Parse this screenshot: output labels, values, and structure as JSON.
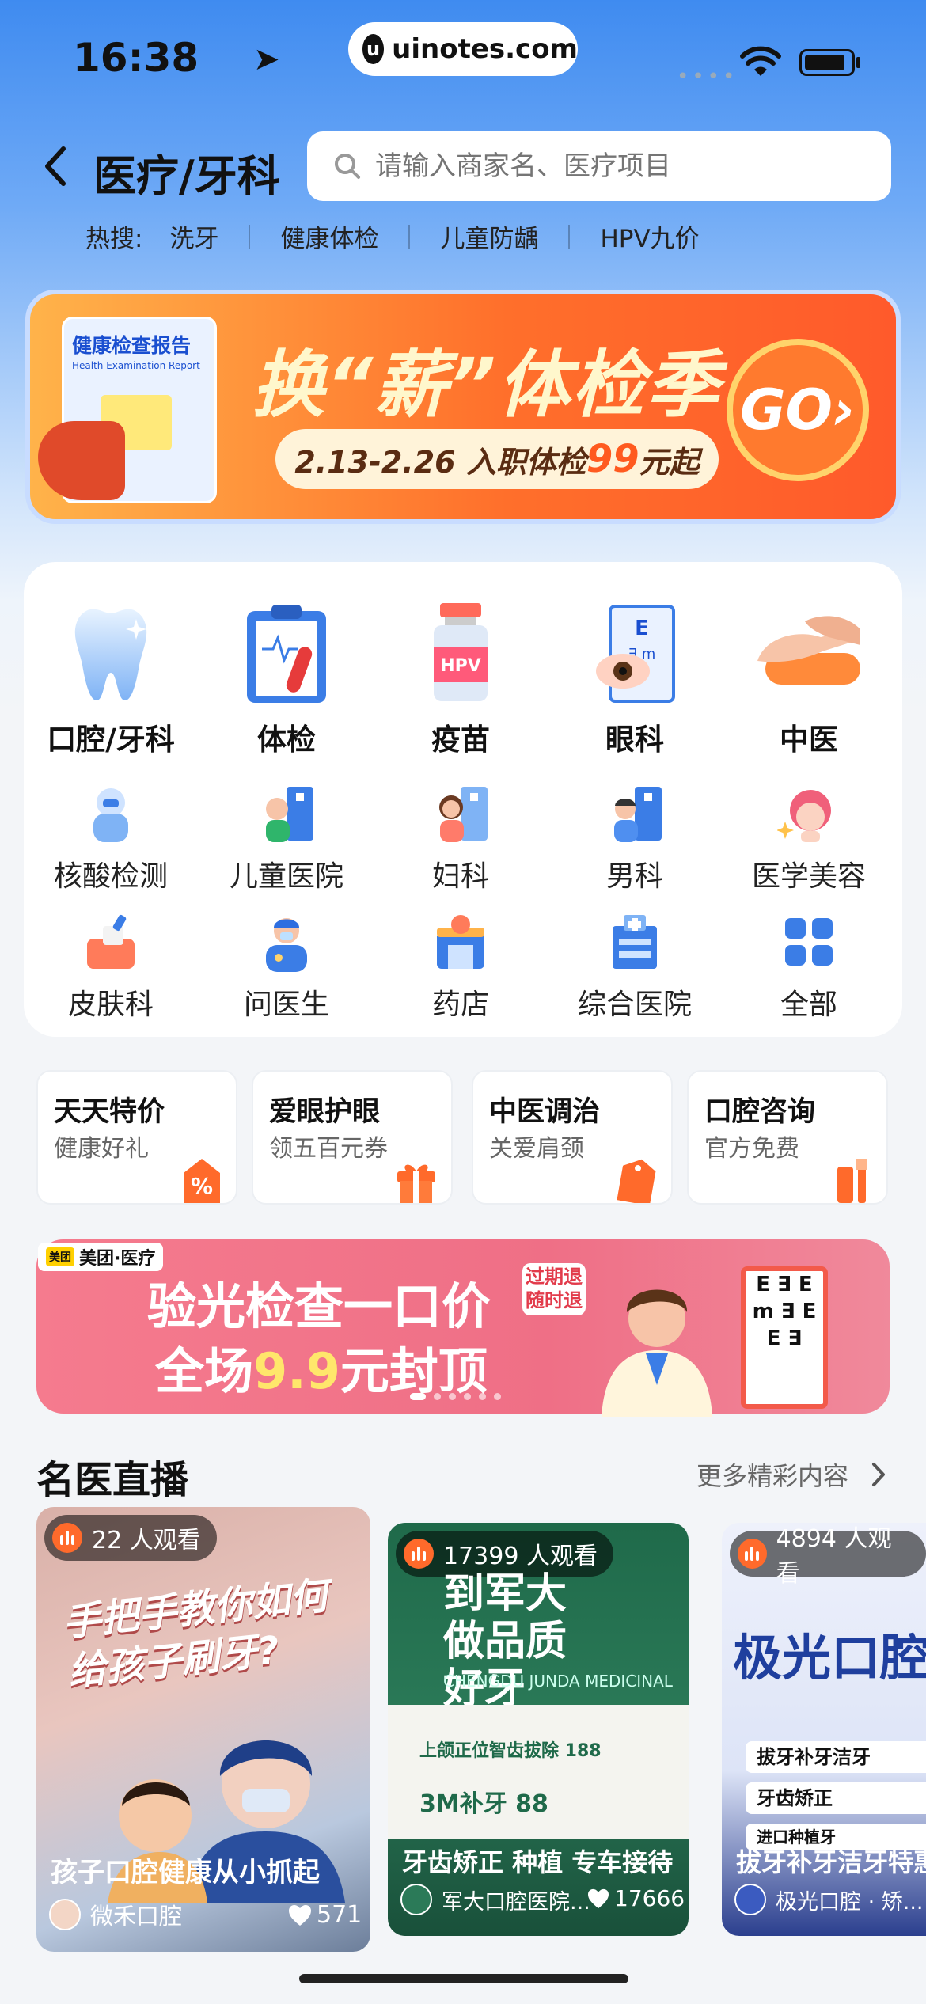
{
  "status": {
    "time": "16:38",
    "url": "uinotes.com",
    "url_logo": "u"
  },
  "header": {
    "title": "医疗/牙科",
    "search_placeholder": "请输入商家名、医疗项目"
  },
  "hot": {
    "label": "热搜:",
    "items": [
      "洗牙",
      "健康体检",
      "儿童防龋",
      "HPV九价"
    ]
  },
  "banner": {
    "report_title": "健康检查报告",
    "report_subtitle": "Health Examination Report",
    "title": "换“薪”体检季",
    "subtitle_prefix": "2.13-2.26 入职体检",
    "subtitle_price": "99",
    "subtitle_suffix": "元起",
    "go": "GO›"
  },
  "categories_main": [
    "口腔/牙科",
    "体检",
    "疫苗",
    "眼科",
    "中医"
  ],
  "categories_row2": [
    "核酸检测",
    "儿童医院",
    "妇科",
    "男科",
    "医学美容"
  ],
  "categories_row3": [
    "皮肤科",
    "问医生",
    "药店",
    "综合医院",
    "全部"
  ],
  "vaccine_label": "HPV",
  "promos": [
    {
      "title": "天天特价",
      "sub": "健康好礼"
    },
    {
      "title": "爱眼护眼",
      "sub": "领五百元券"
    },
    {
      "title": "中医调治",
      "sub": "关爱肩颈"
    },
    {
      "title": "口腔咨询",
      "sub": "官方免费"
    }
  ],
  "ad": {
    "brand": "美团·医疗",
    "brand_mark": "美团",
    "line1": "验光检查一口价",
    "line2_prefix": "全场",
    "line2_highlight": "9.9",
    "line2_suffix": "元封顶",
    "tag": "过期退随时退",
    "eye_chart": "E ∃ E m ∃ E E ∃"
  },
  "live": {
    "title": "名医直播",
    "more": "更多精彩内容",
    "cards": [
      {
        "viewers": "22 人观看",
        "headline": "手把手教你如何给孩子刷牙?",
        "caption": "孩子口腔健康从小抓起",
        "author": "微禾口腔",
        "likes": "571"
      },
      {
        "viewers": "17399 人观看",
        "headline": "到军大做品质好牙",
        "sub": "CHENGDU JUNDA MEDICINAL",
        "items": [
          "上颌正位智齿拔除 188",
          "3M补牙 88"
        ],
        "caption": "牙齿矫正 种植 专车接待",
        "author": "军大口腔医院...",
        "likes": "17666"
      },
      {
        "viewers": "4894 人观看",
        "headline": "极光口腔",
        "items": [
          "拔牙补牙洁牙",
          "牙齿矫正",
          "进口种植牙"
        ],
        "caption": "拔牙补牙洁牙特惠",
        "author": "极光口腔 · 矫..."
      }
    ]
  },
  "colors": {
    "accent": "#ff6a2b",
    "brand_blue": "#3f8bf0"
  }
}
